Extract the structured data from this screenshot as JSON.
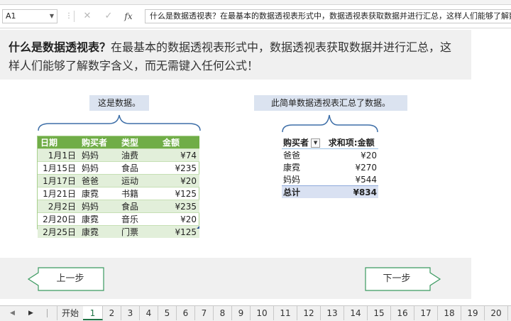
{
  "formula_bar": {
    "name_box": "A1",
    "cancel_icon": "cancel-icon",
    "enter_icon": "checkmark-icon",
    "fx_label": "fx",
    "content": "什么是数据透视表？在最基本的数据透视表形式中，数据透视表获取数据并进行汇总，这样人们能够了解数字含"
  },
  "intro": {
    "bold": "什么是数据透视表？",
    "text": "在最基本的数据透视表形式中，数据透视表获取数据并进行汇总，这样人们能够了解数字含义，而无需键入任何公式！"
  },
  "callouts": {
    "source": "这是数据。",
    "pivot": "此简单数据透视表汇总了数据。"
  },
  "source_table": {
    "headers": [
      "日期",
      "购买者",
      "类型",
      "金额"
    ],
    "rows": [
      [
        "1月1日",
        "妈妈",
        "油费",
        "¥74"
      ],
      [
        "1月15日",
        "妈妈",
        "食品",
        "¥235"
      ],
      [
        "1月17日",
        "爸爸",
        "运动",
        "¥20"
      ],
      [
        "1月21日",
        "康霓",
        "书籍",
        "¥125"
      ],
      [
        "2月2日",
        "妈妈",
        "食品",
        "¥235"
      ],
      [
        "2月20日",
        "康霓",
        "音乐",
        "¥20"
      ],
      [
        "2月25日",
        "康霓",
        "门票",
        "¥125"
      ]
    ]
  },
  "pivot_table": {
    "headers": [
      "购买者",
      "求和项:金额"
    ],
    "rows": [
      [
        "爸爸",
        "¥20"
      ],
      [
        "康霓",
        "¥270"
      ],
      [
        "妈妈",
        "¥544"
      ]
    ],
    "total": [
      "总计",
      "¥834"
    ]
  },
  "nav": {
    "prev": "上一步",
    "next": "下一步"
  },
  "sheet_tabs": {
    "start": "开始",
    "numbers": [
      "1",
      "2",
      "3",
      "4",
      "5",
      "6",
      "7",
      "8",
      "9",
      "10",
      "11",
      "12",
      "13",
      "14",
      "15",
      "16",
      "17",
      "18",
      "19",
      "20"
    ],
    "active": "1"
  },
  "colors": {
    "table_header": "#70ad47",
    "table_band": "#e2efda",
    "callout_bg": "#dbe3f0",
    "brace": "#3e6fa8",
    "nav_border": "#3b9a60",
    "pivot_total": "#d9e1f2"
  }
}
